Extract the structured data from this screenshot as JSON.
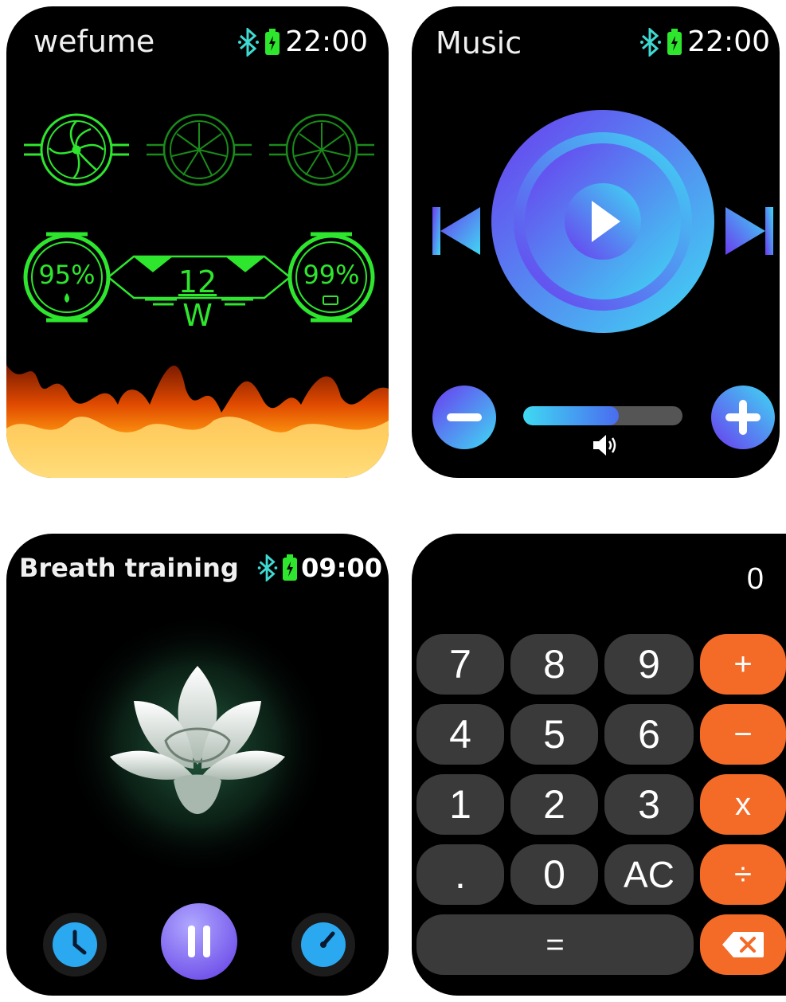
{
  "watchfaces": {
    "vape": {
      "title": "wefume",
      "time": "22:00",
      "left_gauge_value": "95%",
      "right_gauge_value": "99%",
      "power_value": "12",
      "power_unit": "W",
      "accent_color": "#2ee62e"
    },
    "music": {
      "title": "Music",
      "time": "22:00",
      "volume_level": 0.6,
      "accent_colors": [
        "#3fd9f2",
        "#6a3cf0"
      ]
    },
    "breath": {
      "title": "Breath training",
      "time": "09:00"
    },
    "calculator": {
      "display": "0",
      "keys": [
        [
          "7",
          "8",
          "9",
          "+"
        ],
        [
          "4",
          "5",
          "6",
          "−"
        ],
        [
          "1",
          "2",
          "3",
          "x"
        ],
        [
          ".",
          "0",
          "AC",
          "÷"
        ]
      ],
      "equals": "=",
      "backspace_icon": "backspace-icon",
      "operator_color": "#f46a27",
      "key_color": "#3a3a3a"
    }
  }
}
